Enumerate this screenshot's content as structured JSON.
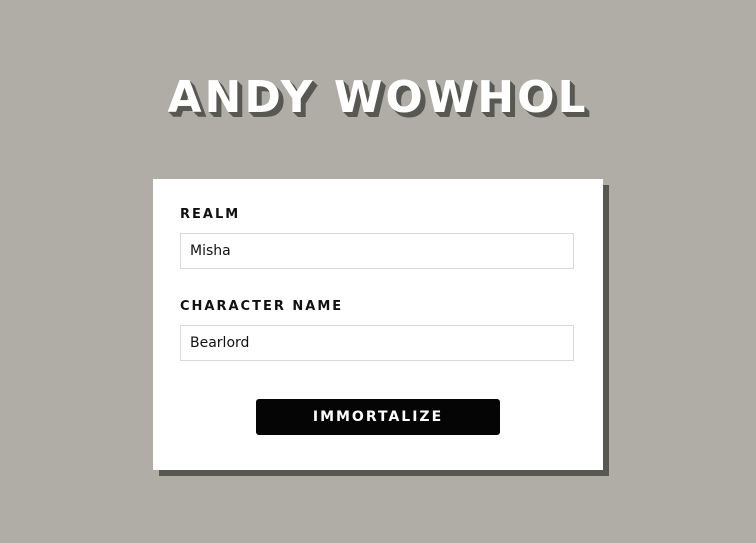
{
  "header": {
    "title": "ANDY WOWHOL"
  },
  "form": {
    "realm_label": "REALM",
    "realm_value": "Misha",
    "character_label": "CHARACTER NAME",
    "character_value": "Bearlord",
    "submit_label": "IMMORTALIZE"
  }
}
